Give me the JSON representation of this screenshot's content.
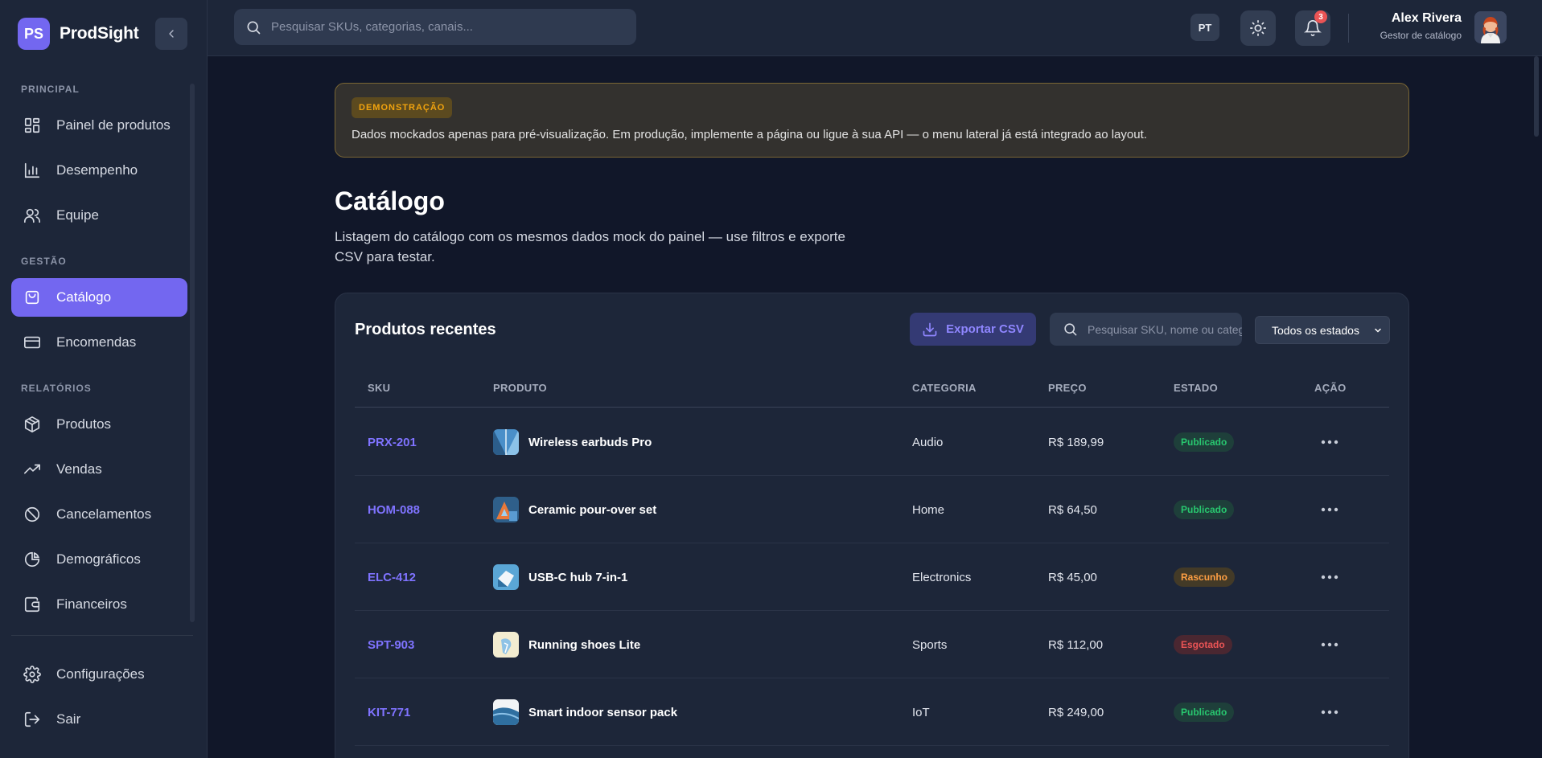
{
  "app": {
    "logo_initials": "PS",
    "name": "ProdSight"
  },
  "sidebar": {
    "sections": [
      {
        "label": "PRINCIPAL"
      },
      {
        "label": "GESTÃO"
      },
      {
        "label": "RELATÓRIOS"
      }
    ],
    "items": [
      {
        "label": "Painel de produtos",
        "icon": "dashboard-icon"
      },
      {
        "label": "Desempenho",
        "icon": "bar-chart-icon"
      },
      {
        "label": "Equipe",
        "icon": "users-icon"
      },
      {
        "label": "Catálogo",
        "icon": "shopping-bag-icon",
        "active": true
      },
      {
        "label": "Encomendas",
        "icon": "credit-card-icon"
      },
      {
        "label": "Produtos",
        "icon": "package-icon"
      },
      {
        "label": "Vendas",
        "icon": "trending-up-icon"
      },
      {
        "label": "Cancelamentos",
        "icon": "ban-icon"
      },
      {
        "label": "Demográficos",
        "icon": "pie-chart-icon"
      },
      {
        "label": "Financeiros",
        "icon": "wallet-icon"
      },
      {
        "label": "Configurações",
        "icon": "gear-icon"
      },
      {
        "label": "Sair",
        "icon": "logout-icon"
      }
    ]
  },
  "topbar": {
    "search_placeholder": "Pesquisar SKUs, categorias, canais...",
    "language": "PT",
    "notifications_count": "3",
    "user_name": "Alex Rivera",
    "user_role": "Gestor de catálogo"
  },
  "demo": {
    "badge": "DEMONSTRAÇÃO",
    "text": "Dados mockados apenas para pré-visualização. Em produção, implemente a página ou ligue à sua API — o menu lateral já está integrado ao layout."
  },
  "page": {
    "title": "Catálogo",
    "description": "Listagem do catálogo com os mesmos dados mock do painel — use filtros e exporte CSV para testar."
  },
  "table": {
    "title": "Produtos recentes",
    "export_label": "Exportar CSV",
    "search_placeholder": "Pesquisar SKU, nome ou categoria",
    "status_filter": "Todos os estados",
    "columns": [
      "SKU",
      "PRODUTO",
      "CATEGORIA",
      "PREÇO",
      "ESTADO",
      "AÇÃO"
    ],
    "rows": [
      {
        "sku": "PRX-201",
        "product": "Wireless earbuds Pro",
        "category": "Audio",
        "price": "R$ 189,99",
        "status": "Publicado",
        "status_type": "published"
      },
      {
        "sku": "HOM-088",
        "product": "Ceramic pour-over set",
        "category": "Home",
        "price": "R$ 64,50",
        "status": "Publicado",
        "status_type": "published"
      },
      {
        "sku": "ELC-412",
        "product": "USB-C hub 7-in-1",
        "category": "Electronics",
        "price": "R$ 45,00",
        "status": "Rascunho",
        "status_type": "draft"
      },
      {
        "sku": "SPT-903",
        "product": "Running shoes Lite",
        "category": "Sports",
        "price": "R$ 112,00",
        "status": "Esgotado",
        "status_type": "out"
      },
      {
        "sku": "KIT-771",
        "product": "Smart indoor sensor pack",
        "category": "IoT",
        "price": "R$ 249,00",
        "status": "Publicado",
        "status_type": "published"
      }
    ]
  },
  "colors": {
    "accent": "#7367f0",
    "published": "#28c76f",
    "draft": "#ff9f43",
    "out": "#ea5455"
  }
}
